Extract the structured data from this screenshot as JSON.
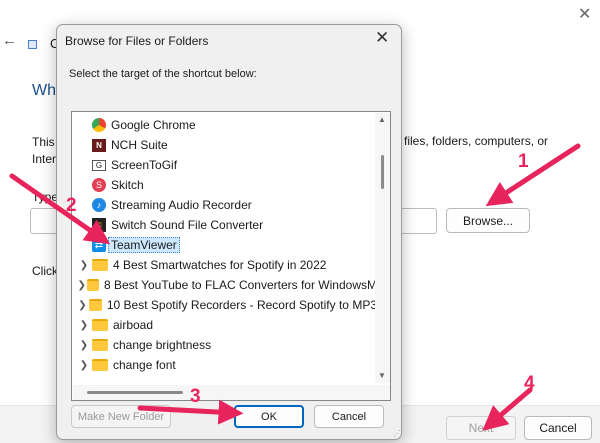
{
  "background": {
    "title_fragment": "C",
    "heading_fragment": "Wh",
    "desc_line1_fragment": "This",
    "desc_line2_fragment": "Inter",
    "desc_right_text": "files, folders, computers, or",
    "type_label_fragment": "Type",
    "browse_label": "Browse...",
    "click_text_fragment": "Click",
    "next_label": "Next",
    "cancel_label": "Cancel"
  },
  "dialog": {
    "title": "Browse for Files or Folders",
    "instruction": "Select the target of the shortcut below:",
    "tree_items": [
      {
        "label": "Google Chrome",
        "icon": "chrome-icon",
        "expandable": false,
        "selected": false
      },
      {
        "label": "NCH Suite",
        "icon": "nch-icon",
        "expandable": false,
        "selected": false
      },
      {
        "label": "ScreenToGif",
        "icon": "screentogif-icon",
        "expandable": false,
        "selected": false
      },
      {
        "label": "Skitch",
        "icon": "skitch-icon",
        "expandable": false,
        "selected": false
      },
      {
        "label": "Streaming Audio Recorder",
        "icon": "streaming-audio-icon",
        "expandable": false,
        "selected": false
      },
      {
        "label": "Switch Sound File Converter",
        "icon": "switch-icon",
        "expandable": false,
        "selected": false
      },
      {
        "label": "TeamViewer",
        "icon": "teamviewer-icon",
        "expandable": false,
        "selected": true
      },
      {
        "label": "4 Best Smartwatches for Spotify in 2022",
        "icon": "folder-icon",
        "expandable": true,
        "selected": false
      },
      {
        "label": "8 Best YouTube to FLAC Converters for WindowsM",
        "icon": "folder-icon",
        "expandable": true,
        "selected": false
      },
      {
        "label": "10 Best Spotify Recorders - Record Spotify to MP3",
        "icon": "folder-icon",
        "expandable": true,
        "selected": false
      },
      {
        "label": "airboad",
        "icon": "folder-icon",
        "expandable": true,
        "selected": false
      },
      {
        "label": "change brightness",
        "icon": "folder-icon",
        "expandable": true,
        "selected": false
      },
      {
        "label": "change font",
        "icon": "folder-icon",
        "expandable": true,
        "selected": false
      }
    ],
    "new_folder_label": "Make New Folder",
    "ok_label": "OK",
    "cancel_label": "Cancel"
  },
  "annotations": {
    "step1": "1",
    "step2": "2",
    "step3": "3",
    "step4": "4",
    "arrow_color": "#e8245c"
  }
}
